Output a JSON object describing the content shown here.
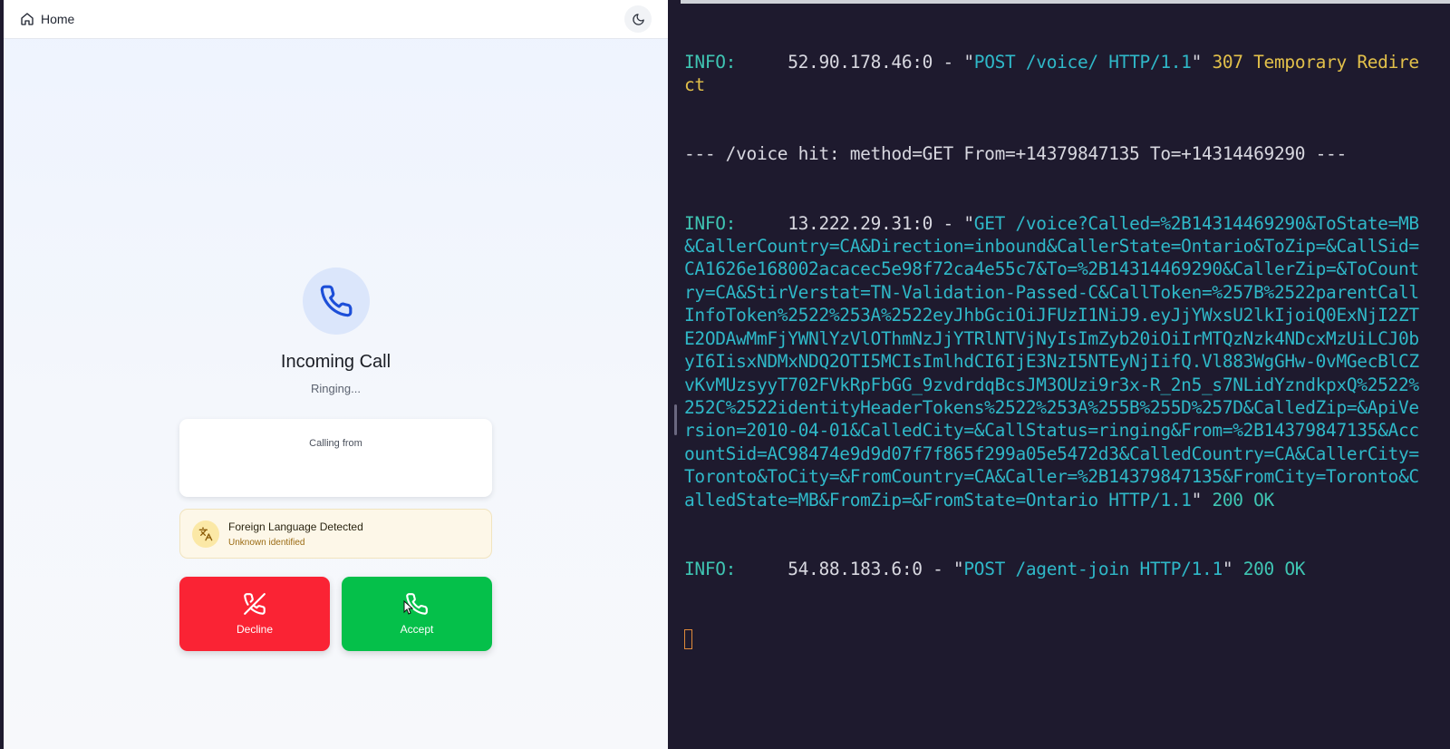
{
  "nav": {
    "home_label": "Home"
  },
  "call": {
    "title": "Incoming Call",
    "status": "Ringing...",
    "calling_from_label": "Calling from",
    "language_title": "Foreign Language Detected",
    "language_subtitle": "Unknown identified",
    "decline_label": "Decline",
    "accept_label": "Accept"
  },
  "colors": {
    "decline": "#fa2334",
    "accept": "#05c04a",
    "accent_blue": "#1d4fd8",
    "terminal_bg": "#1e1a2e"
  },
  "terminal": {
    "line1": {
      "prefix": "INFO:",
      "addr": "     52.90.178.46:0 - \"",
      "request": "POST /voice/ HTTP/1.1",
      "quote": "\" ",
      "status": "307 Temporary Redirect"
    },
    "line2": "--- /voice hit: method=GET From=+14379847135 To=+14314469290 ---",
    "line3": {
      "prefix": "INFO:",
      "addr": "     13.222.29.31:0 - \"",
      "request": "GET /voice?Called=%2B14314469290&ToState=MB&CallerCountry=CA&Direction=inbound&CallerState=Ontario&ToZip=&CallSid=CA1626e168002acacec5e98f72ca4e55c7&To=%2B14314469290&CallerZip=&ToCountry=CA&StirVerstat=TN-Validation-Passed-C&CallToken=%257B%2522parentCallInfoToken%2522%253A%2522eyJhbGciOiJFUzI1NiJ9.eyJjYWxsU2lkIjoiQ0ExNjI2ZTE2ODAwMmFjYWNlYzVlOThmNzJjYTRlNTVjNyIsImZyb20iOiIrMTQzNzk4NDcxMzUiLCJ0byI6IisxNDMxNDQ2OTI5MCIsImlhdCI6IjE3NzI5NTEyNjIifQ.Vl883WgGHw-0vMGecBlCZvKvMUzsyyT702FVkRpFbGG_9zvdrdqBcsJM3OUzi9r3x-R_2n5_s7NLidYzndkpxQ%2522%252C%2522identityHeaderTokens%2522%253A%255B%255D%257D&CalledZip=&ApiVersion=2010-04-01&CalledCity=&CallStatus=ringing&From=%2B14379847135&AccountSid=AC98474e9d9d07f7f865f299a05e5472d3&CalledCountry=CA&CallerCity=Toronto&ToCity=&FromCountry=CA&Caller=%2B14379847135&FromCity=Toronto&CalledState=MB&FromZip=&FromState=Ontario HTTP/1.1",
      "quote": "\" ",
      "status": "200 OK"
    },
    "line4": {
      "prefix": "INFO:",
      "addr": "     54.88.183.6:0 - \"",
      "request": "POST /agent-join HTTP/1.1",
      "quote": "\" ",
      "status": "200 OK"
    }
  }
}
